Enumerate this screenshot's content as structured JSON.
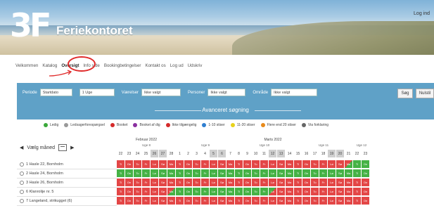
{
  "header": {
    "site_name": "Feriekontoret",
    "logo_text": "3F",
    "login": "Log ind"
  },
  "nav": {
    "items": [
      "Velkommen",
      "Katalog",
      "Oversigt",
      "Info side",
      "Bookingbetingelser",
      "Kontakt os",
      "Log ud",
      "Udskriv"
    ],
    "active_index": 2
  },
  "search": {
    "fields": [
      {
        "label": "Periode",
        "value": "Startdato"
      },
      {
        "label": "",
        "value": "1 Uge"
      },
      {
        "label": "Værelser",
        "value": "Ikke valgt"
      },
      {
        "label": "Personer",
        "value": "Ikke valgt"
      },
      {
        "label": "Område",
        "value": "Ikke valgt"
      }
    ],
    "search_button": "Søg",
    "reset_button": "Nulstil",
    "advanced_label": "Avanceret søgning"
  },
  "legend": [
    {
      "label": "Ledig",
      "color": "#3aa83a"
    },
    {
      "label": "Ledsagerforespørgsel",
      "color": "#999999"
    },
    {
      "label": "Booket",
      "color": "#d42a2a"
    },
    {
      "label": "Booket af dig",
      "color": "#8a2fa0"
    },
    {
      "label": "Ikke tilgængelig",
      "color": "#d42a2a"
    },
    {
      "label": "1-10 stiser",
      "color": "#2f7fd0"
    },
    {
      "label": "11-20 stiser",
      "color": "#e8d21a"
    },
    {
      "label": "Flere end 20 stiser",
      "color": "#e88a1a"
    },
    {
      "label": "Via forklaring",
      "color": "#666666"
    }
  ],
  "calendar": {
    "nav_label": "Vælg måned",
    "prev_icon": "chevron-left-icon",
    "next_icon": "chevron-right-icon",
    "months": [
      {
        "name": "Februar 2022",
        "weeks": [
          "Uge 8"
        ]
      },
      {
        "name": "Marts 2022",
        "weeks": [
          "Uge 9",
          "Uge 10",
          "Uge 11",
          "Uge 12"
        ]
      }
    ],
    "days": [
      "22",
      "23",
      "24",
      "25",
      "26",
      "27",
      "28",
      "1",
      "2",
      "3",
      "4",
      "5",
      "6",
      "7",
      "8",
      "9",
      "10",
      "11",
      "12",
      "13",
      "14",
      "15",
      "16",
      "17",
      "18",
      "19",
      "20",
      "21",
      "22",
      "23"
    ],
    "weekend_indices": [
      4,
      5,
      11,
      12,
      18,
      19,
      25,
      26
    ],
    "units": [
      {
        "name": "1 Hasle 22, Bornholm",
        "status": "rrrrrrrrrrrrrrrrrrrrrrrrrrrxgg"
      },
      {
        "name": "2 Hasle 24, Bornholm",
        "status": "ggggggggggggggggggggggggggggggg"
      },
      {
        "name": "3 Hasle 26, Bornholm",
        "status": "rrrrrrrrrrrrrrrrrrrrrrrrrrrrrr"
      },
      {
        "name": "6 Klanrolije nr. 5",
        "status": "rrrrrrxgggggggggggyrrrrrrrrrrr"
      },
      {
        "name": "7 Langeland, strikugget (6)",
        "status": "rrrrrrrrrrrrrrrrrrrrrrrrrrrrrr"
      }
    ],
    "day_codes": [
      "Ti",
      "On",
      "To",
      "Fr",
      "Lø",
      "Sø",
      "Ma",
      "Ti",
      "On",
      "To",
      "Fr",
      "Lø",
      "Sø",
      "Ma",
      "Ti",
      "On",
      "To",
      "Fr",
      "Lø",
      "Sø",
      "Ma",
      "Ti",
      "On",
      "To",
      "Fr",
      "Lø",
      "Sø",
      "Ma",
      "Ti",
      "On"
    ]
  }
}
